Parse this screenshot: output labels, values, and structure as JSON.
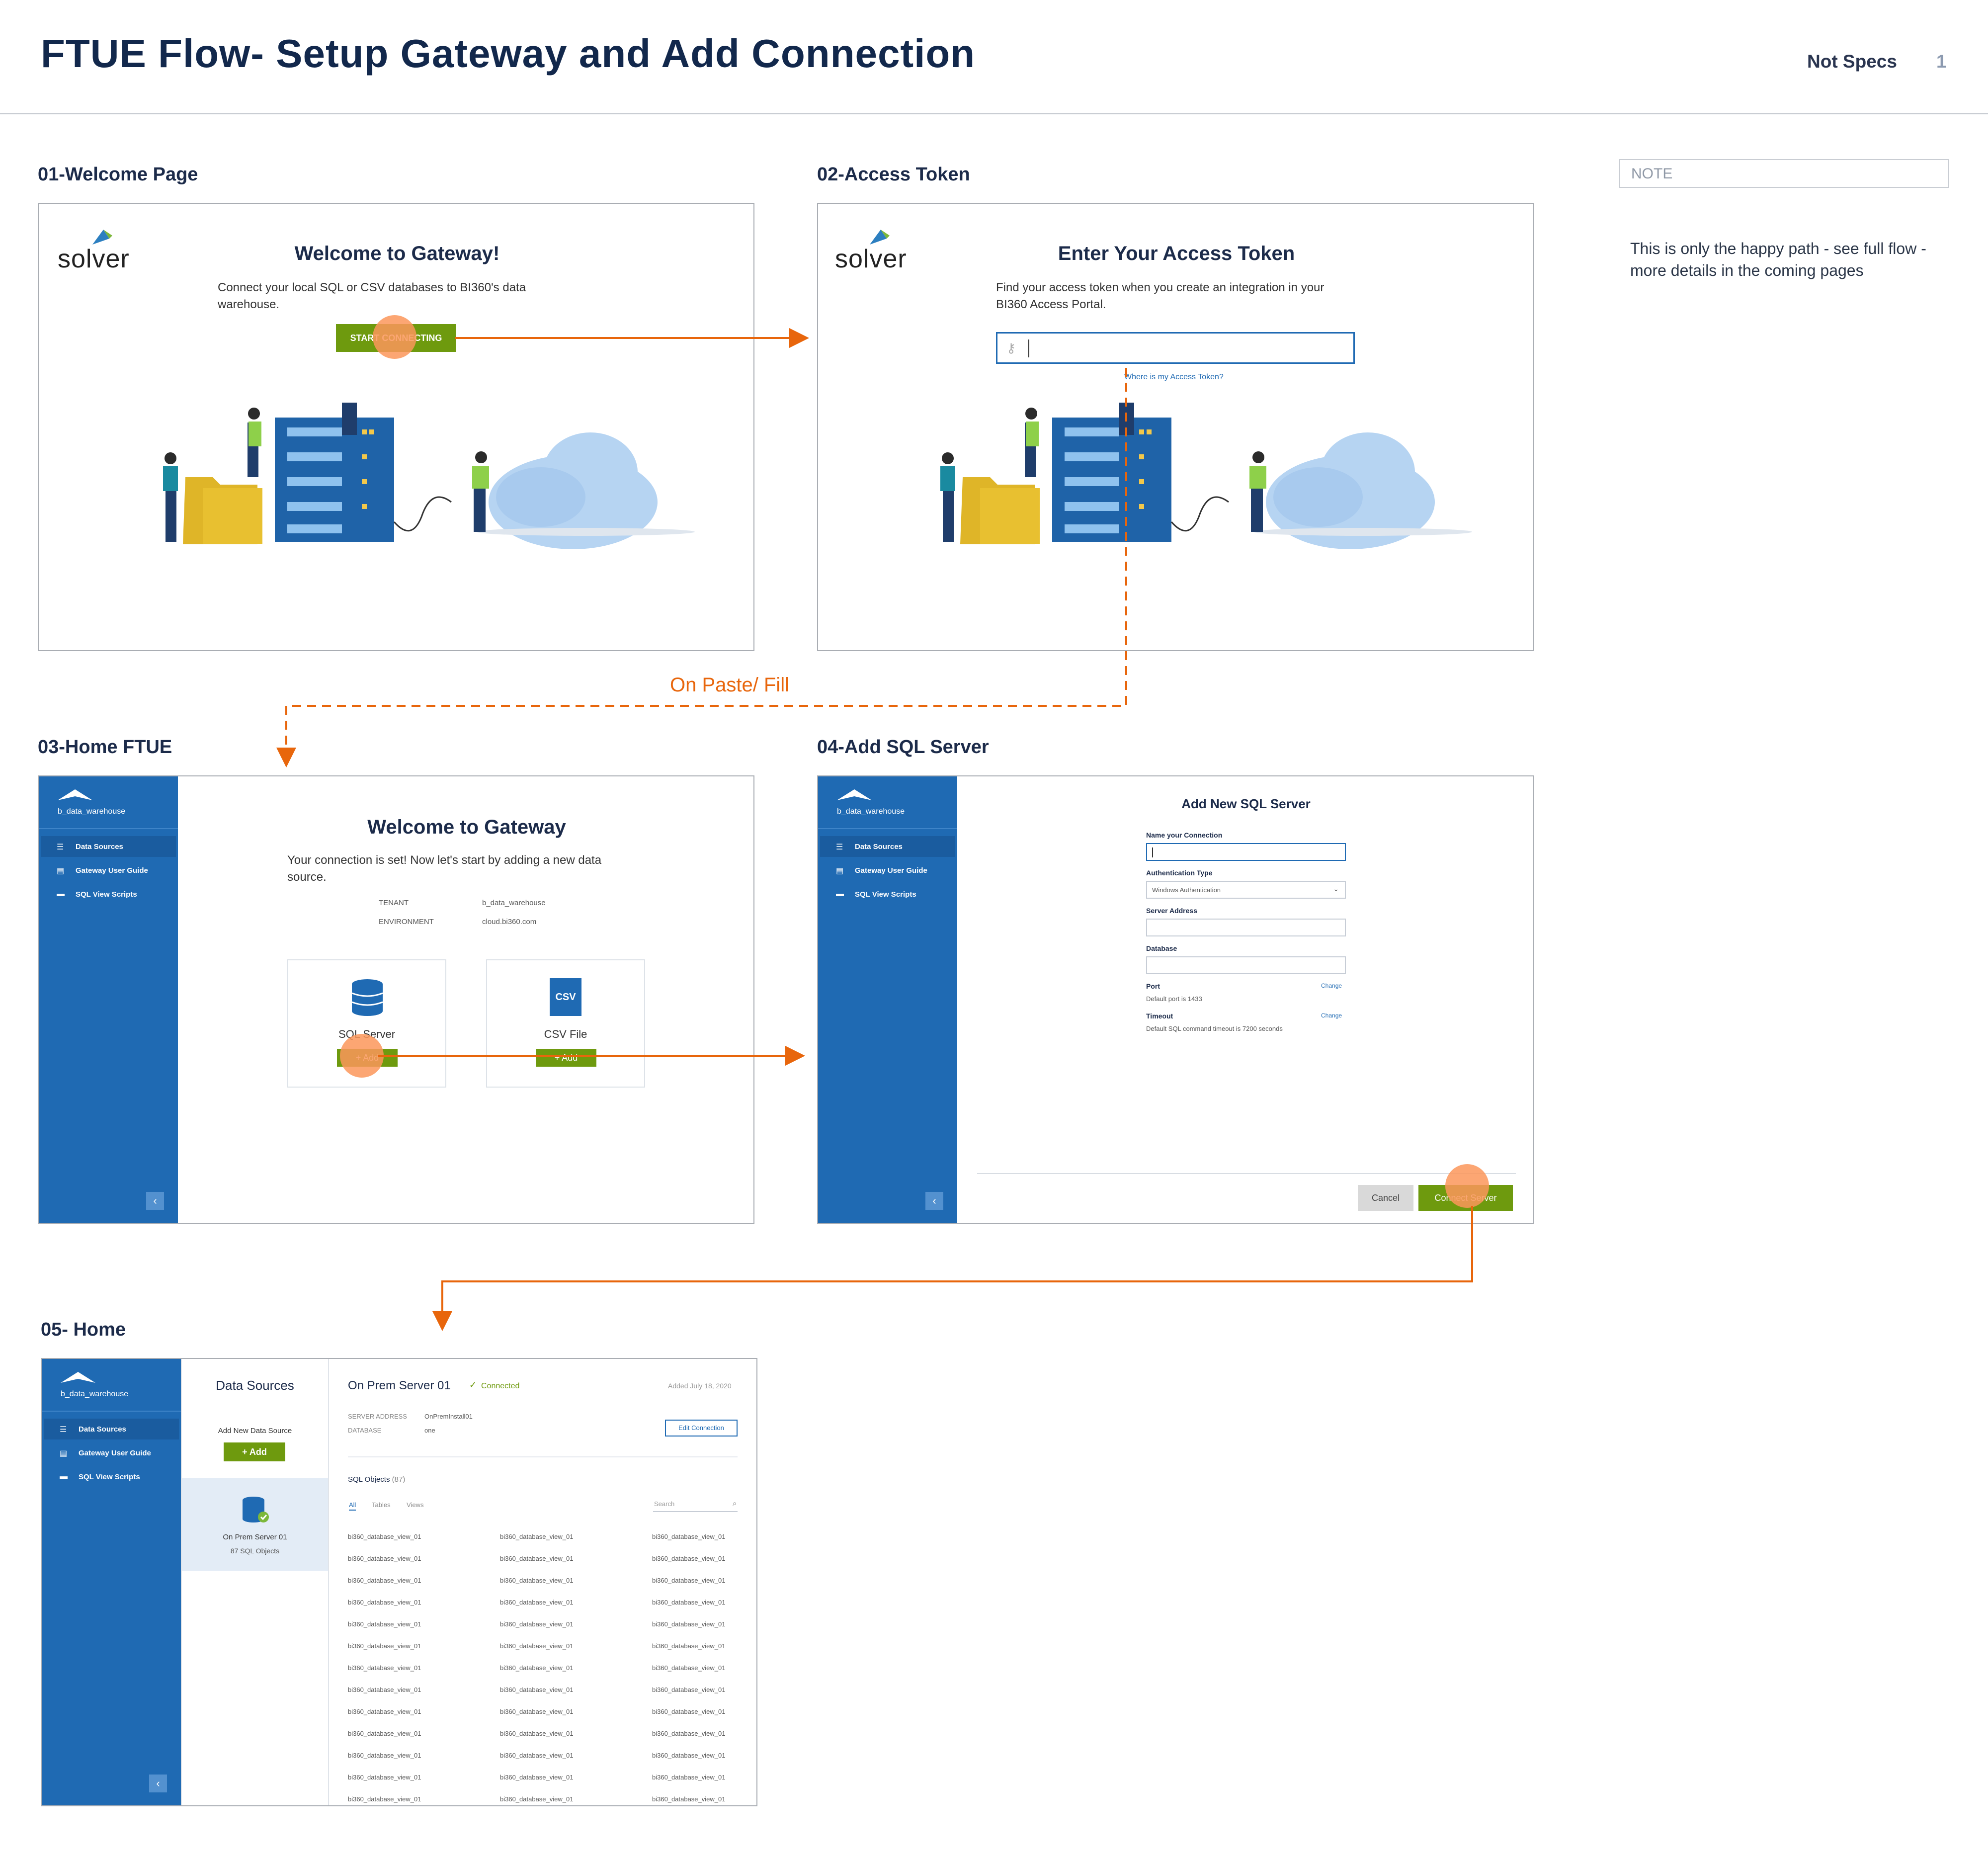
{
  "header": {
    "title": "FTUE Flow- Setup Gateway and Add Connection",
    "status": "Not Specs",
    "page": "1"
  },
  "note": {
    "label": "NOTE",
    "text": "This is only the happy path - see full flow - more details in the coming pages"
  },
  "flow": {
    "paste_label": "On Paste/ Fill"
  },
  "s1": {
    "title": "01-Welcome Page",
    "logo": "solver",
    "heading": "Welcome to Gateway!",
    "body": "Connect your local SQL or CSV databases to BI360's data warehouse.",
    "button": "START CONNECTING"
  },
  "s2": {
    "title": "02-Access Token",
    "logo": "solver",
    "heading": "Enter Your Access Token",
    "body": "Find your access token when you create an integration in your BI360 Access Portal.",
    "link": "Where is my Access Token?"
  },
  "sidebar": {
    "name": "b_data_warehouse",
    "items": [
      "Data Sources",
      "Gateway User Guide",
      "SQL View Scripts"
    ]
  },
  "s3": {
    "title": "03-Home FTUE",
    "heading": "Welcome to Gateway",
    "body": "Your connection is set! Now let's start by adding a new data source.",
    "tenant_label": "TENANT",
    "tenant_value": "b_data_warehouse",
    "env_label": "ENVIRONMENT",
    "env_value": "cloud.bi360.com",
    "sql_label": "SQL Server",
    "csv_label": "CSV File",
    "csv_badge": "CSV",
    "add": "+ Add"
  },
  "s4": {
    "title": "04-Add SQL Server",
    "heading": "Add New SQL Server",
    "name_label": "Name your Connection",
    "auth_label": "Authentication Type",
    "auth_value": "Windows Authentication",
    "server_label": "Server Address",
    "db_label": "Database",
    "port_label": "Port",
    "port_help": "Default port is 1433",
    "timeout_label": "Timeout",
    "timeout_help": "Default SQL command timeout is 7200 seconds",
    "change": "Change",
    "cancel": "Cancel",
    "connect": "Connect Server"
  },
  "s5": {
    "title": "05- Home",
    "panel_title": "Data Sources",
    "add_new": "Add New Data Source",
    "add": "+ Add",
    "source_name": "On Prem Server 01",
    "source_objects": "87 SQL Objects",
    "server_title": "On Prem Server 01",
    "connected": "Connected",
    "added": "Added July 18, 2020",
    "addr_label": "SERVER ADDRESS",
    "addr_value": "OnPremInstall01",
    "db_label": "DATABASE",
    "db_value": "one",
    "edit": "Edit Connection",
    "objects_title": "SQL Objects",
    "objects_count": "(87)",
    "tabs": [
      "All",
      "Tables",
      "Views"
    ],
    "search": "Search",
    "item": "bi360_database_view_01"
  },
  "colors": {
    "brand_blue": "#1f6ab3",
    "green": "#6e9a0e",
    "orange": "#e8660c",
    "navy": "#12284c"
  }
}
